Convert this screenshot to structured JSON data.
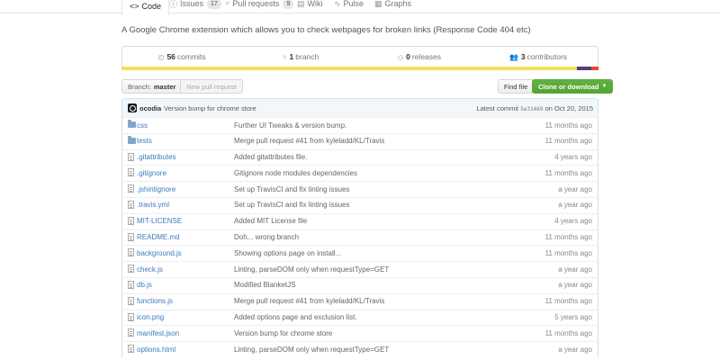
{
  "tabs": [
    {
      "label": "Code",
      "icon": "code-icon",
      "glyph": "<>",
      "counter": ""
    },
    {
      "label": "Issues",
      "icon": "issue-icon",
      "glyph": "ⓘ",
      "counter": "17"
    },
    {
      "label": "Pull requests",
      "icon": "pull-request-icon",
      "glyph": "⑂",
      "counter": "9"
    },
    {
      "label": "Wiki",
      "icon": "book-icon",
      "glyph": "▤",
      "counter": ""
    },
    {
      "label": "Pulse",
      "icon": "pulse-icon",
      "glyph": "∿",
      "counter": ""
    },
    {
      "label": "Graphs",
      "icon": "graph-icon",
      "glyph": "▦",
      "counter": ""
    }
  ],
  "description": "A Google Chrome extension which allows you to check webpages for broken links (Response Code 404 etc)",
  "summary": {
    "commits": {
      "count": "56",
      "label": "commits"
    },
    "branches": {
      "count": "1",
      "label": "branch"
    },
    "releases": {
      "count": "0",
      "label": "releases"
    },
    "contributors": {
      "count": "3",
      "label": "contributors"
    }
  },
  "colors": {
    "lang_bar": [
      "#f1e05a",
      "#563d7c",
      "#e34c26"
    ],
    "accent": "#4078c0",
    "primary_button": "#55a532"
  },
  "branch_button": {
    "prefix": "Branch:",
    "name": "master"
  },
  "new_pr_label": "New pull request",
  "find_file_label": "Find file",
  "clone_label": "Clone or download",
  "commit": {
    "author": "ocodia",
    "message": "Version bump for chrome store",
    "latest_prefix": "Latest commit",
    "sha": "5e31469",
    "date": "on Oct 20, 2015"
  },
  "files": [
    {
      "type": "dir",
      "name": "css",
      "message": "Further UI Tweaks & version bump.",
      "age": "11 months ago"
    },
    {
      "type": "dir",
      "name": "tests",
      "message": "Merge pull request #41 from kyleladd/KL/Travis",
      "age": "11 months ago"
    },
    {
      "type": "file",
      "name": ".gitattributes",
      "message": "Added gitattributes file.",
      "age": "4 years ago"
    },
    {
      "type": "file",
      "name": ".gitignore",
      "message": "Gitignore node modules dependencies",
      "age": "11 months ago"
    },
    {
      "type": "file",
      "name": ".jshintignore",
      "message": "Set up TravisCI and fix linting issues",
      "age": "a year ago"
    },
    {
      "type": "file",
      "name": ".travis.yml",
      "message": "Set up TravisCI and fix linting issues",
      "age": "a year ago"
    },
    {
      "type": "file",
      "name": "MIT-LICENSE",
      "message": "Added MIT License file",
      "age": "4 years ago"
    },
    {
      "type": "file",
      "name": "README.md",
      "message": "Doh... wrong branch",
      "age": "11 months ago"
    },
    {
      "type": "file",
      "name": "background.js",
      "message": "Showing options page on install...",
      "age": "11 months ago"
    },
    {
      "type": "file",
      "name": "check.js",
      "message": "Linting, parseDOM only when requestType=GET",
      "age": "a year ago"
    },
    {
      "type": "file",
      "name": "db.js",
      "message": "Modified BlanketJS",
      "age": "a year ago"
    },
    {
      "type": "file",
      "name": "functions.js",
      "message": "Merge pull request #41 from kyleladd/KL/Travis",
      "age": "11 months ago"
    },
    {
      "type": "file",
      "name": "icon.png",
      "message": "Added options page and exclusion list.",
      "age": "5 years ago"
    },
    {
      "type": "file",
      "name": "manifest.json",
      "message": "Version bump for chrome store",
      "age": "11 months ago"
    },
    {
      "type": "file",
      "name": "options.html",
      "message": "Linting, parseDOM only when requestType=GET",
      "age": "a year ago"
    }
  ]
}
